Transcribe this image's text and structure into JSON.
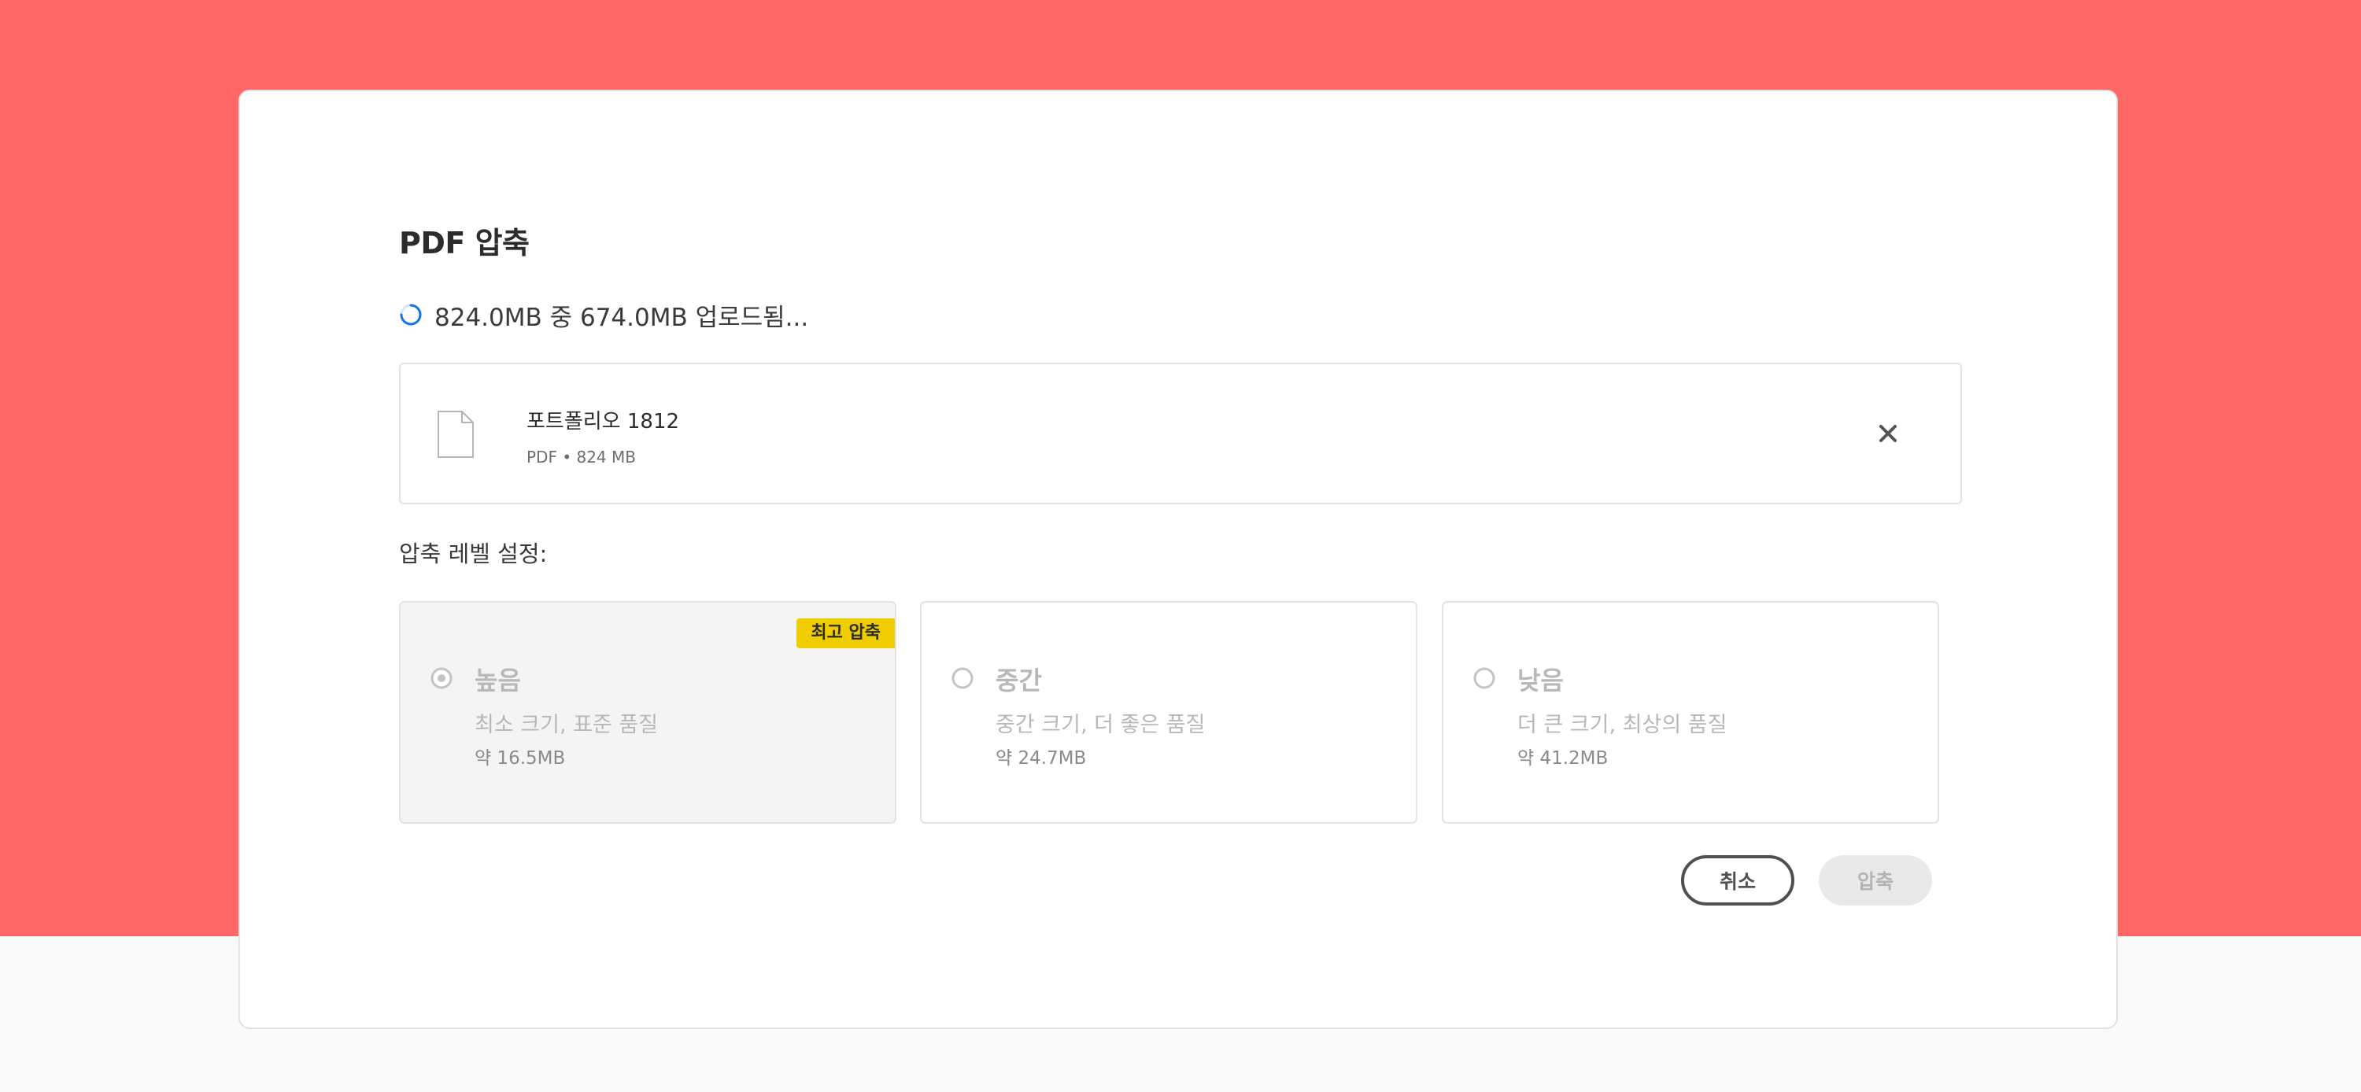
{
  "dialog": {
    "title": "PDF 압축",
    "upload_status": "824.0MB 중 674.0MB 업로드됨..."
  },
  "file": {
    "name": "포트폴리오 1812",
    "meta": "PDF • 824 MB"
  },
  "compression": {
    "label": "압축 레벨 설정:",
    "options": [
      {
        "title": "높음",
        "description": "최소 크기, 표준 품질",
        "size": "약 16.5MB",
        "badge": "최고 압축",
        "selected": true
      },
      {
        "title": "중간",
        "description": "중간 크기, 더 좋은 품질",
        "size": "약 24.7MB",
        "selected": false
      },
      {
        "title": "낮음",
        "description": "더 큰 크기, 최상의 품질",
        "size": "약 41.2MB",
        "selected": false
      }
    ]
  },
  "actions": {
    "cancel_label": "취소",
    "compress_label": "압축"
  },
  "colors": {
    "brand_background": "#ff6666",
    "badge": "#f0cd00",
    "spinner": "#1473e6"
  },
  "icons": {
    "spinner": "loading-spinner-icon",
    "file": "document-icon",
    "remove": "close-icon",
    "radio": "radio-icon"
  }
}
